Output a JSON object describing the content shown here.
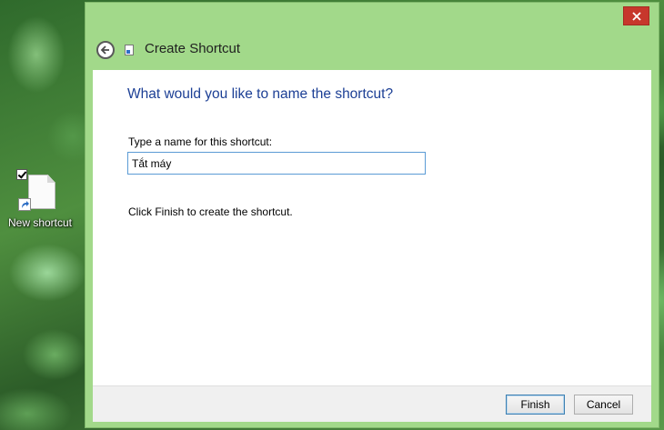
{
  "desktop": {
    "icon": {
      "label": "New shortcut",
      "selected_checkbox": true,
      "icon_name": "file-shortcut-icon"
    }
  },
  "dialog": {
    "title": "Create Shortcut",
    "close_icon": "close-icon",
    "back_icon": "back-arrow-icon",
    "heading": "What would you like to name the shortcut?",
    "name_label": "Type a name for this shortcut:",
    "name_value": "Tắt máy",
    "finish_instruction": "Click Finish to create the shortcut.",
    "buttons": {
      "finish": "Finish",
      "cancel": "Cancel"
    },
    "colors": {
      "frame": "#a2d98a",
      "close": "#c7372c",
      "heading": "#1c3f95",
      "input_border": "#5b9bd5"
    }
  }
}
